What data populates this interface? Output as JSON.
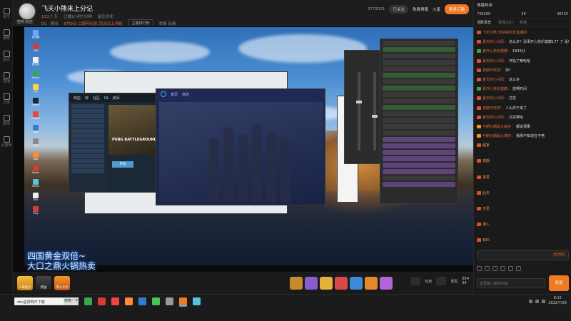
{
  "rail": {
    "items": [
      {
        "label": "关注",
        "icon": "follow-icon"
      },
      {
        "label": "推荐",
        "icon": "recommend-icon"
      },
      {
        "label": "首页",
        "icon": "home-icon"
      },
      {
        "label": "直播",
        "icon": "live-icon"
      },
      {
        "label": "分类",
        "icon": "category-icon"
      },
      {
        "label": "赛事",
        "icon": "match-icon"
      },
      {
        "label": "云游戏",
        "icon": "cloud-game-icon"
      }
    ]
  },
  "header": {
    "avatar_tag": "签到 粉丝",
    "title": "飞天小熊来上分记",
    "fans": "123.7 万",
    "status": "已播1小时7分钟",
    "category": "星乐文化",
    "room_label": "DL · 房间",
    "notice": "9月9日 二周年纪念 活动马上开始",
    "gift_btn": "主播排行榜",
    "report": "举报 反馈",
    "room_id": "3772031",
    "btn_follow": "已关注",
    "btn_free": "免费得笔",
    "btn_rank": "火星",
    "btn_subscribe": "更多订阅"
  },
  "stream": {
    "overlay_line1": "四国黄金双倍~",
    "overlay_line2": "大口之鼎火锅热卖",
    "launcher_tabs": [
      "首页",
      "商店"
    ],
    "steam_tabs": [
      "商店",
      "库",
      "社区",
      "DL · 房间"
    ],
    "steam_game": "PUBG BATTLEGROUNDS",
    "steam_play": "开始"
  },
  "controls": {
    "left_badges": [
      "三联超大",
      "奖励",
      "带火大片"
    ],
    "right_labels": [
      "热度",
      "重配"
    ],
    "right_count_1": "854",
    "right_count_2": "54"
  },
  "chat": {
    "header_title": "弹幕粉丝",
    "stats": [
      "738289",
      "58",
      "48335"
    ],
    "tabs": [
      "活跃贵宾",
      "贵宾(16)",
      "粉丝"
    ],
    "messages": [
      {
        "kind": "sys",
        "name": "飞天小熊",
        "text": "欢迎来到本直播间"
      },
      {
        "kind": "user",
        "lv": "r",
        "name": "夏天的小冷风：",
        "text": "这么多？没事开心快乐健康177 了 是吧"
      },
      {
        "kind": "user",
        "lv": "g",
        "name": "夏开心快乐健康：",
        "text": "1639分"
      },
      {
        "kind": "user",
        "lv": "r",
        "name": "夏天的小冷风：",
        "text": "开始了嘛哈哈"
      },
      {
        "kind": "user",
        "lv": "r",
        "name": "夜期不吃草：",
        "text": "帅？"
      },
      {
        "kind": "user",
        "lv": "r",
        "name": "夏天的小冷风：",
        "text": "这么多"
      },
      {
        "kind": "user",
        "lv": "g",
        "name": "夏开心快乐健康：",
        "text": "放啊时间"
      },
      {
        "kind": "user",
        "lv": "r",
        "name": "夏天的小冷风：",
        "text": "打扰"
      },
      {
        "kind": "user",
        "lv": "r",
        "name": "夜期不吃草：",
        "text": "人头终于来了"
      },
      {
        "kind": "user",
        "lv": "r",
        "name": "夏天的小冷风：",
        "text": "打扰啊哈"
      },
      {
        "kind": "user",
        "lv": "o",
        "name": "与朝元朝是大家好：",
        "text": "都说语果"
      },
      {
        "kind": "user",
        "lv": "o",
        "name": "与朝元朝是大家好：",
        "text": "我那不知道在干啥"
      },
      {
        "kind": "gift",
        "lv": "r",
        "name": "超家谈T97",
        "text": "赠送 勤效完来捧"
      },
      {
        "kind": "gift",
        "lv": "r",
        "name": "夜期小飞羊",
        "text": "赠送 我和飞彩"
      },
      {
        "kind": "gift",
        "lv": "r",
        "name": "来赞吉乐乐是",
        "text": "赠送 新战完米棒"
      },
      {
        "kind": "gift",
        "lv": "r",
        "name": "后天天舞起：",
        "text": "赠送 大气"
      },
      {
        "kind": "gift",
        "lv": "r",
        "name": "天至贵秘银：",
        "text": "赠送 大气"
      },
      {
        "kind": "gift",
        "lv": "r",
        "name": "通人气一下",
        "text": "赠送 大气"
      },
      {
        "kind": "gift",
        "lv": "r",
        "name": "有KING大门流量主",
        "text": "赠送 大气"
      },
      {
        "kind": "gift",
        "lv": "r",
        "name": "我在1 · 的西特简",
        "text": "赠送 大气"
      }
    ],
    "input_count": "0253",
    "send_placeholder": "这里输入聊天内容",
    "send_label": "发送"
  },
  "taskbar": {
    "search_text": "obs显屏软件下载",
    "search_btn": "搜索一下",
    "time": "8:15",
    "date": "2022/7/29"
  },
  "colors": {
    "accent": "#f07a24",
    "name_color": "#e26a3c",
    "chat_bg": "#1a1a1a"
  }
}
